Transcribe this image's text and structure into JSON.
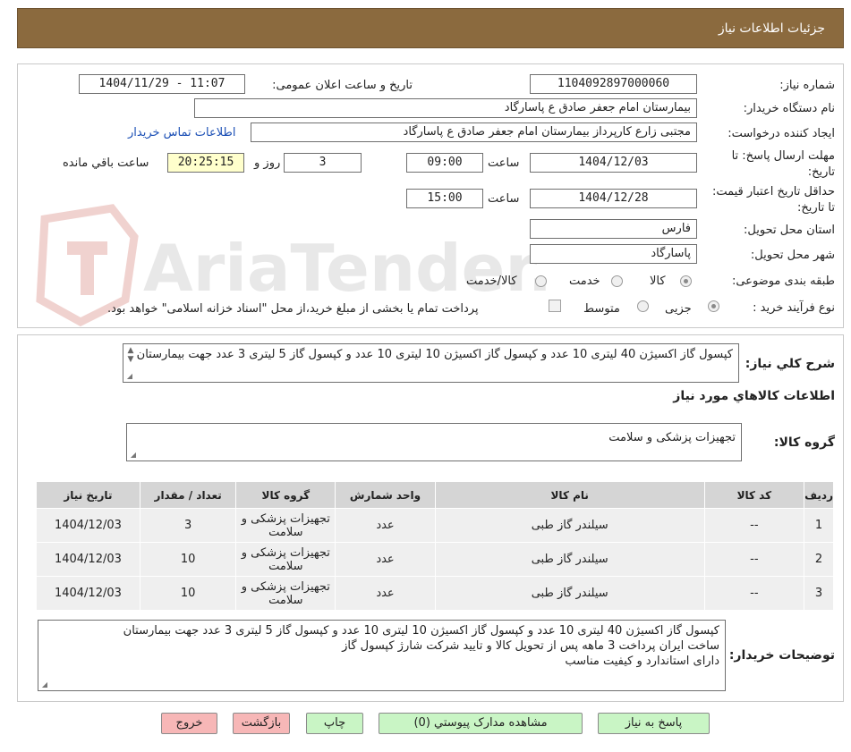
{
  "header": {
    "title": "جزئیات اطلاعات نیاز"
  },
  "form": {
    "need_number_label": "شماره نیاز:",
    "need_number": "1104092897000060",
    "announce_label": "تاریخ و ساعت اعلان عمومی:",
    "announce_value": "1404/11/29 - 11:07",
    "buyer_org_label": "نام دستگاه خریدار:",
    "buyer_org": "بیمارستان امام جعفر صادق ع  پاسارگاد",
    "creator_label": "ایجاد کننده درخواست:",
    "creator": "مجتبی زارع کارپرداز بیمارستان امام جعفر صادق ع  پاسارگاد",
    "contact_link": "اطلاعات تماس خریدار",
    "reply_deadline_label": "مهلت ارسال پاسخ: تا تاریخ:",
    "reply_date": "1404/12/03",
    "time_label": "ساعت",
    "reply_time": "09:00",
    "days_value": "3",
    "days_label": "روز و",
    "remaining_time": "20:25:15",
    "remaining_label": "ساعت باقي مانده",
    "validity_label": "حداقل تاریخ اعتبار قیمت: تا تاریخ:",
    "validity_date": "1404/12/28",
    "validity_time_label": "ساعت",
    "validity_time": "15:00",
    "province_label": "استان محل تحویل:",
    "province": "فارس",
    "city_label": "شهر محل تحویل:",
    "city": "پاسارگاد",
    "category_label": "طبقه بندی موضوعی:",
    "category_options": [
      "کالا",
      "خدمت",
      "کالا/خدمت"
    ],
    "process_label": "نوع فرآیند خرید :",
    "process_options": [
      "جزیی",
      "متوسط"
    ],
    "payment_note": "پرداخت تمام یا بخشی از مبلغ خرید،از محل \"اسناد خزانه اسلامی\" خواهد بود."
  },
  "summary": {
    "label": "شرح كلي نياز:",
    "text": "کپسول گاز اکسیژن 40 لیتری 10 عدد و کپسول گاز اکسیژن 10 لیتری 10 عدد و کپسول گاز 5 لیتری 3 عدد جهت بیمارستان",
    "items_title": "اطلاعات كالاهاي مورد نياز",
    "group_label": "گروه کالا:",
    "group_value": "تجهیزات پزشکی و سلامت"
  },
  "table": {
    "headers": [
      "ردیف",
      "کد کالا",
      "نام کالا",
      "واحد شمارش",
      "گروه کالا",
      "تعداد / مقدار",
      "تاریخ نیاز"
    ],
    "rows": [
      [
        "1",
        "--",
        "سیلندر گاز طبی",
        "عدد",
        "تجهیزات پزشکی و سلامت",
        "3",
        "1404/12/03"
      ],
      [
        "2",
        "--",
        "سیلندر گاز طبی",
        "عدد",
        "تجهیزات پزشکی و سلامت",
        "10",
        "1404/12/03"
      ],
      [
        "3",
        "--",
        "سیلندر گاز طبی",
        "عدد",
        "تجهیزات پزشکی و سلامت",
        "10",
        "1404/12/03"
      ]
    ]
  },
  "buyer_notes": {
    "label": "توضیحات خریدار:",
    "line1": "کپسول گاز اکسیژن 40 لیتری 10 عدد و کپسول گاز اکسیژن 10 لیتری 10 عدد و کپسول گاز 5 لیتری 3 عدد جهت بیمارستان",
    "line2": "ساخت ایران پرداخت 3 ماهه پس از تحویل کالا و تایید شرکت شارژ کپسول گاز",
    "line3": "دارای استاندارد و کیفیت مناسب"
  },
  "buttons": {
    "reply": "پاسخ به نياز",
    "attachments": "مشاهده مدارک پيوستي (0)",
    "print": "چاپ",
    "back": "بازگشت",
    "exit": "خروج"
  },
  "watermark": {
    "text": "AriaTender.neT"
  },
  "colors": {
    "header": "#8b6a3e",
    "button_green": "#c9f5c5",
    "button_pink": "#f7b7b7",
    "link": "#1b4fb5",
    "timer_bg": "#ffffcc"
  }
}
